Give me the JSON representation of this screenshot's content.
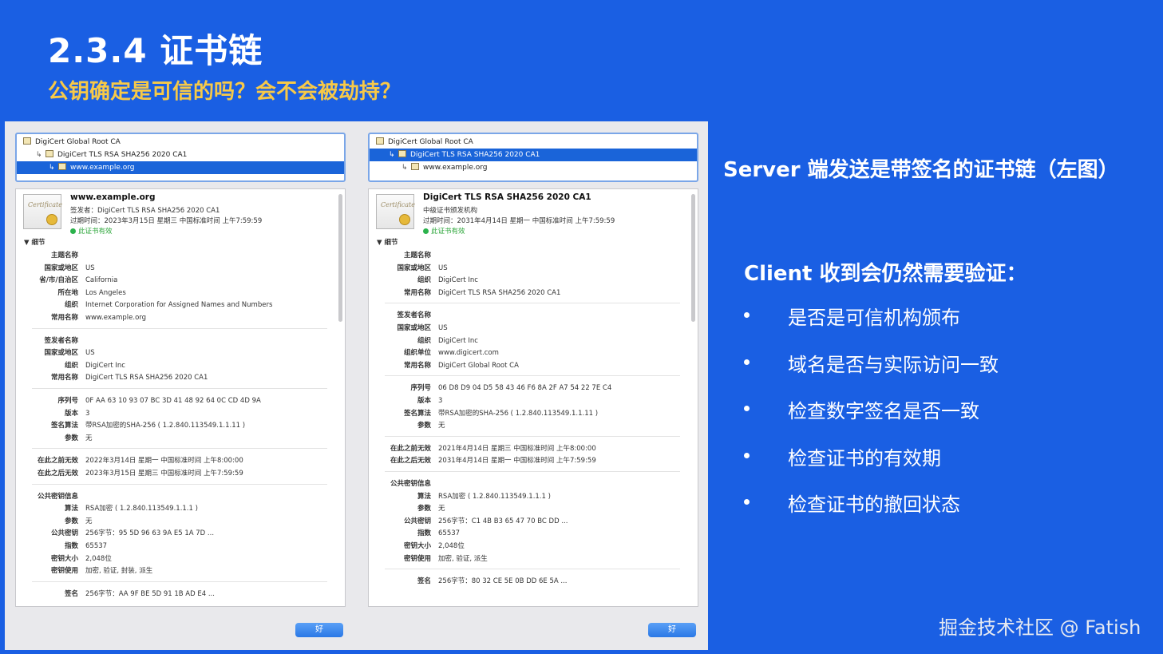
{
  "slide": {
    "title": "2.3.4 证书链",
    "subtitle": "公钥确定是可信的吗？会不会被劫持？",
    "server_text": "Server 端发送是带签名的证书链（左图）",
    "client_text": "Client 收到会仍然需要验证：",
    "bullets": [
      "是否是可信机构颁布",
      "域名是否与实际访问一致",
      "检查数字签名是否一致",
      "检查证书的有效期",
      "检查证书的撤回状态"
    ],
    "watermark": "掘金技术社区 @ Fatish"
  },
  "left": {
    "tree": [
      "DigiCert Global Root CA",
      "DigiCert TLS RSA SHA256 2020 CA1",
      "www.example.org"
    ],
    "selected_index": 2,
    "icon_text": "Certificate",
    "cert_name": "www.example.org",
    "issuer_line": "签发者：DigiCert TLS RSA SHA256 2020 CA1",
    "expiry_line": "过期时间：2023年3月15日 星期三 中国标准时间 上午7:59:59",
    "valid_line": "此证书有效",
    "details_label": "细节",
    "ok_label": "好",
    "groups": [
      [
        {
          "k": "主题名称",
          "v": ""
        },
        {
          "k": "国家或地区",
          "v": "US"
        },
        {
          "k": "省/市/自治区",
          "v": "California"
        },
        {
          "k": "所在地",
          "v": "Los Angeles"
        },
        {
          "k": "组织",
          "v": "Internet Corporation for Assigned Names and Numbers"
        },
        {
          "k": "常用名称",
          "v": "www.example.org"
        }
      ],
      [
        {
          "k": "签发者名称",
          "v": ""
        },
        {
          "k": "国家或地区",
          "v": "US"
        },
        {
          "k": "组织",
          "v": "DigiCert Inc"
        },
        {
          "k": "常用名称",
          "v": "DigiCert TLS RSA SHA256 2020 CA1"
        }
      ],
      [
        {
          "k": "序列号",
          "v": "0F AA 63 10 93 07 BC 3D 41 48 92 64 0C CD 4D 9A"
        },
        {
          "k": "版本",
          "v": "3"
        },
        {
          "k": "签名算法",
          "v": "带RSA加密的SHA-256 ( 1.2.840.113549.1.1.11 )"
        },
        {
          "k": "参数",
          "v": "无"
        }
      ],
      [
        {
          "k": "在此之前无效",
          "v": "2022年3月14日 星期一 中国标准时间 上午8:00:00"
        },
        {
          "k": "在此之后无效",
          "v": "2023年3月15日 星期三 中国标准时间 上午7:59:59"
        }
      ],
      [
        {
          "k": "公共密钥信息",
          "v": ""
        },
        {
          "k": "算法",
          "v": "RSA加密 ( 1.2.840.113549.1.1.1 )"
        },
        {
          "k": "参数",
          "v": "无"
        },
        {
          "k": "公共密钥",
          "v": "256字节：95 5D 96 63 9A E5 1A 7D ..."
        },
        {
          "k": "指数",
          "v": "65537"
        },
        {
          "k": "密钥大小",
          "v": "2,048位"
        },
        {
          "k": "密钥使用",
          "v": "加密, 验证, 封装, 派生"
        }
      ],
      [
        {
          "k": "签名",
          "v": "256字节：AA 9F BE 5D 91 1B AD E4 ..."
        }
      ]
    ]
  },
  "right": {
    "tree": [
      "DigiCert Global Root CA",
      "DigiCert TLS RSA SHA256 2020 CA1",
      "www.example.org"
    ],
    "selected_index": 1,
    "icon_text": "Certificate",
    "cert_name": "DigiCert TLS RSA SHA256 2020 CA1",
    "issuer_line": "中级证书颁发机构",
    "expiry_line": "过期时间：2031年4月14日 星期一 中国标准时间 上午7:59:59",
    "valid_line": "此证书有效",
    "details_label": "细节",
    "ok_label": "好",
    "groups": [
      [
        {
          "k": "主题名称",
          "v": ""
        },
        {
          "k": "国家或地区",
          "v": "US"
        },
        {
          "k": "组织",
          "v": "DigiCert Inc"
        },
        {
          "k": "常用名称",
          "v": "DigiCert TLS RSA SHA256 2020 CA1"
        }
      ],
      [
        {
          "k": "签发者名称",
          "v": ""
        },
        {
          "k": "国家或地区",
          "v": "US"
        },
        {
          "k": "组织",
          "v": "DigiCert Inc"
        },
        {
          "k": "组织单位",
          "v": "www.digicert.com"
        },
        {
          "k": "常用名称",
          "v": "DigiCert Global Root CA"
        }
      ],
      [
        {
          "k": "序列号",
          "v": "06 D8 D9 04 D5 58 43 46 F6 8A 2F A7 54 22 7E C4"
        },
        {
          "k": "版本",
          "v": "3"
        },
        {
          "k": "签名算法",
          "v": "带RSA加密的SHA-256 ( 1.2.840.113549.1.1.11 )"
        },
        {
          "k": "参数",
          "v": "无"
        }
      ],
      [
        {
          "k": "在此之前无效",
          "v": "2021年4月14日 星期三 中国标准时间 上午8:00:00"
        },
        {
          "k": "在此之后无效",
          "v": "2031年4月14日 星期一 中国标准时间 上午7:59:59"
        }
      ],
      [
        {
          "k": "公共密钥信息",
          "v": ""
        },
        {
          "k": "算法",
          "v": "RSA加密 ( 1.2.840.113549.1.1.1 )"
        },
        {
          "k": "参数",
          "v": "无"
        },
        {
          "k": "公共密钥",
          "v": "256字节：C1 4B B3 65 47 70 BC DD ..."
        },
        {
          "k": "指数",
          "v": "65537"
        },
        {
          "k": "密钥大小",
          "v": "2,048位"
        },
        {
          "k": "密钥使用",
          "v": "加密, 验证, 派生"
        }
      ],
      [
        {
          "k": "签名",
          "v": "256字节：80 32 CE 5E 0B DD 6E 5A ..."
        }
      ]
    ]
  }
}
